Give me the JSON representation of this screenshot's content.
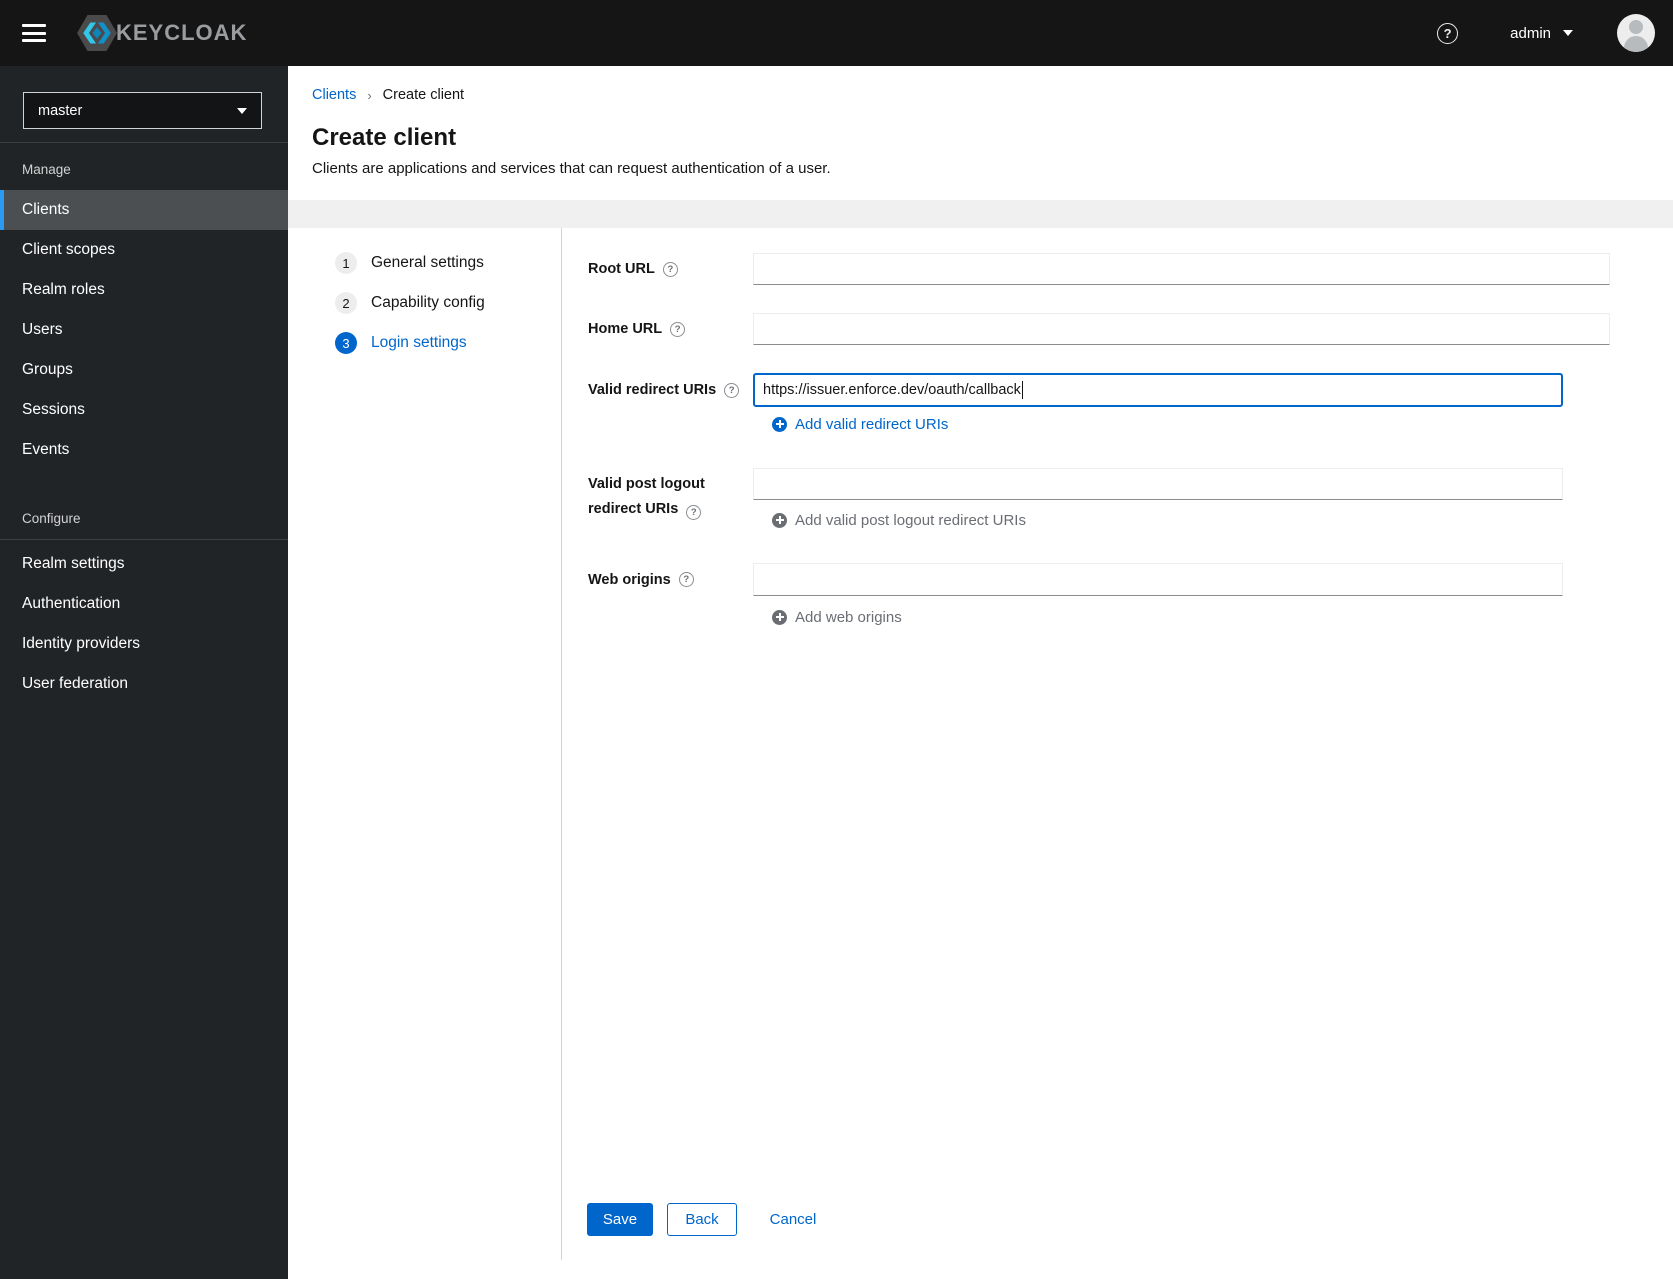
{
  "masthead": {
    "brand": "KEYCLOAK",
    "username": "admin"
  },
  "sidebar": {
    "realm_selector": {
      "value": "master"
    },
    "sections": [
      {
        "title": "Manage",
        "items": [
          {
            "label": "Clients",
            "active": true
          },
          {
            "label": "Client scopes"
          },
          {
            "label": "Realm roles"
          },
          {
            "label": "Users"
          },
          {
            "label": "Groups"
          },
          {
            "label": "Sessions"
          },
          {
            "label": "Events"
          }
        ]
      },
      {
        "title": "Configure",
        "items": [
          {
            "label": "Realm settings"
          },
          {
            "label": "Authentication"
          },
          {
            "label": "Identity providers"
          },
          {
            "label": "User federation"
          }
        ]
      }
    ]
  },
  "breadcrumb": {
    "parent": "Clients",
    "current": "Create client"
  },
  "page_header": {
    "title": "Create client",
    "subtitle": "Clients are applications and services that can request authentication of a user."
  },
  "wizard": {
    "steps": [
      {
        "number": "1",
        "label": "General settings",
        "active": false
      },
      {
        "number": "2",
        "label": "Capability config",
        "active": false
      },
      {
        "number": "3",
        "label": "Login settings",
        "active": true
      }
    ]
  },
  "form": {
    "root_url": {
      "label": "Root URL",
      "value": ""
    },
    "home_url": {
      "label": "Home URL",
      "value": ""
    },
    "valid_redirect_uris": {
      "label": "Valid redirect URIs",
      "value": "https://issuer.enforce.dev/oauth/callback",
      "add_label": "Add valid redirect URIs"
    },
    "valid_post_logout_redirect_uris": {
      "label_line1": "Valid post logout",
      "label_line2": "redirect URIs",
      "value": "",
      "add_label": "Add valid post logout redirect URIs"
    },
    "web_origins": {
      "label": "Web origins",
      "value": "",
      "add_label": "Add web origins"
    }
  },
  "actions": {
    "save": "Save",
    "back": "Back",
    "cancel": "Cancel"
  },
  "colors": {
    "accent": "#0066cc",
    "masthead_bg": "#151515",
    "sidebar_bg": "#212427",
    "active_nav_bg": "#4c4f52",
    "active_nav_border": "#2b9af3",
    "muted_text": "#6a6e73",
    "input_bottom_border": "#8a8d90"
  }
}
